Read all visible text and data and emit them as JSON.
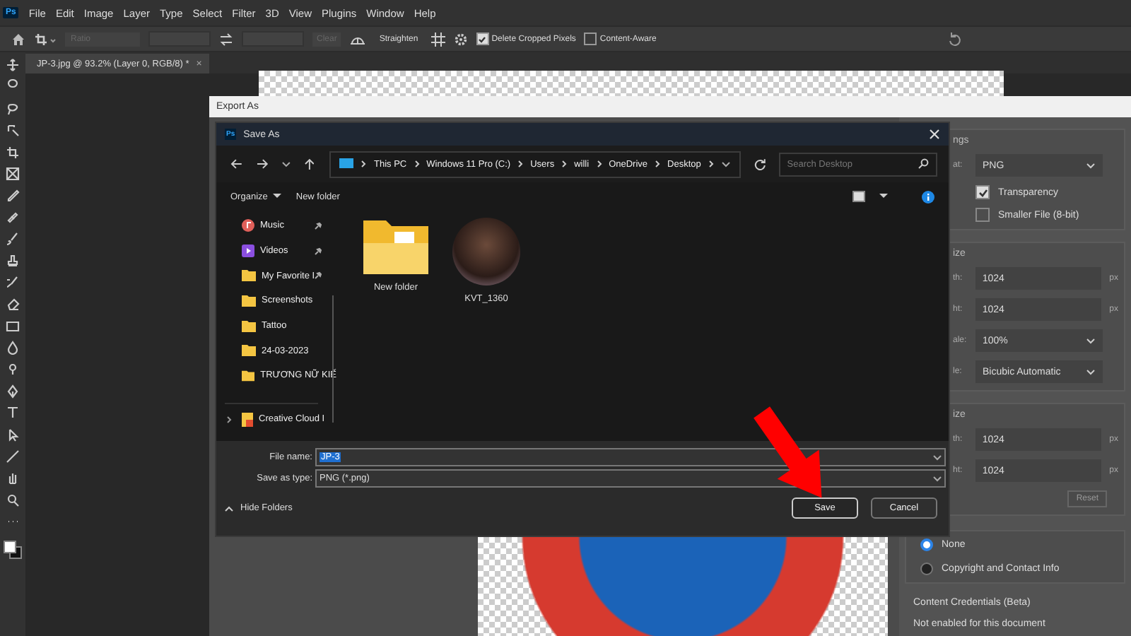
{
  "app": {
    "logo": "Ps"
  },
  "menu_bar": {
    "items": [
      "File",
      "Edit",
      "Image",
      "Layer",
      "Type",
      "Select",
      "Filter",
      "3D",
      "View",
      "Plugins",
      "Window",
      "Help"
    ]
  },
  "options_bar": {
    "ratio": {
      "value": "Ratio",
      "disabled": true
    },
    "buttons": [
      {
        "label": "Clear",
        "disabled": true
      },
      {
        "label": "Straighten",
        "disabled": false
      }
    ],
    "options": [
      {
        "label": "Delete Cropped Pixels",
        "checked": true
      },
      {
        "label": "Content-Aware",
        "checked": false
      }
    ]
  },
  "document_tab": {
    "title": "JP-3.jpg @ 93.2% (Layer 0, RGB/8) *",
    "close": "×"
  },
  "export_dialog": {
    "title": "Export As",
    "settings_heading": "ngs",
    "format": {
      "label": "at:",
      "value": "PNG"
    },
    "checkboxes": [
      {
        "label": "Transparency",
        "checked": true
      },
      {
        "label": "Smaller File (8-bit)",
        "checked": false
      }
    ],
    "image_size_heading": "ize",
    "image_size_rows": [
      {
        "kind": "field",
        "label": "th:",
        "value": "1024",
        "unit": "px"
      },
      {
        "kind": "field",
        "label": "ht:",
        "value": "1024",
        "unit": "px"
      },
      {
        "kind": "select",
        "label": "ale:",
        "value": "100%"
      },
      {
        "kind": "select",
        "label": "le:",
        "value": "Bicubic Automatic"
      }
    ],
    "canvas_size_heading": "ize",
    "canvas_size_rows": [
      {
        "kind": "field",
        "label": "th:",
        "value": "1024",
        "unit": "px"
      },
      {
        "kind": "field",
        "label": "ht:",
        "value": "1024",
        "unit": "px"
      }
    ],
    "reset_button": {
      "label": "Reset",
      "disabled": true
    },
    "metadata_options": [
      {
        "label": "None",
        "selected": true
      },
      {
        "label": "Copyright and Contact Info",
        "selected": false
      }
    ],
    "credentials": {
      "heading": "Content Credentials (Beta)",
      "note": "Not enabled for this document"
    }
  },
  "save_dialog": {
    "logo": "Ps",
    "title": "Save As",
    "breadcrumb": [
      "This PC",
      "Windows 11 Pro (C:)",
      "Users",
      "willi",
      "OneDrive",
      "Desktop"
    ],
    "search": {
      "placeholder": "Search Desktop"
    },
    "toolbar": {
      "organize": "Organize",
      "new_folder": "New folder"
    },
    "sidebar": [
      {
        "label": "Music",
        "kind": "music",
        "pinned": true
      },
      {
        "label": "Videos",
        "kind": "video",
        "pinned": true
      },
      {
        "label": "My Favorite I",
        "kind": "folder",
        "pinned": true
      },
      {
        "label": "Screenshots",
        "kind": "folder",
        "pinned": false
      },
      {
        "label": "Tattoo",
        "kind": "folder",
        "pinned": false
      },
      {
        "label": "24-03-2023",
        "kind": "folder",
        "pinned": false
      },
      {
        "label": "TRƯƠNG NỮ KIẾ",
        "kind": "folder",
        "pinned": false
      },
      {
        "label": "Creative Cloud I",
        "kind": "cloud",
        "pinned": false
      }
    ],
    "files": [
      {
        "name": "New folder",
        "kind": "folder"
      },
      {
        "name": "KVT_1360",
        "kind": "photo"
      }
    ],
    "file_name": {
      "label": "File name:",
      "value": "JP-3"
    },
    "save_as_type": {
      "label": "Save as type:",
      "value": "PNG (*.png)"
    },
    "hide_folders": "Hide Folders",
    "buttons": [
      {
        "label": "Save",
        "kind": "primary"
      },
      {
        "label": "Cancel",
        "kind": "secondary"
      }
    ]
  }
}
